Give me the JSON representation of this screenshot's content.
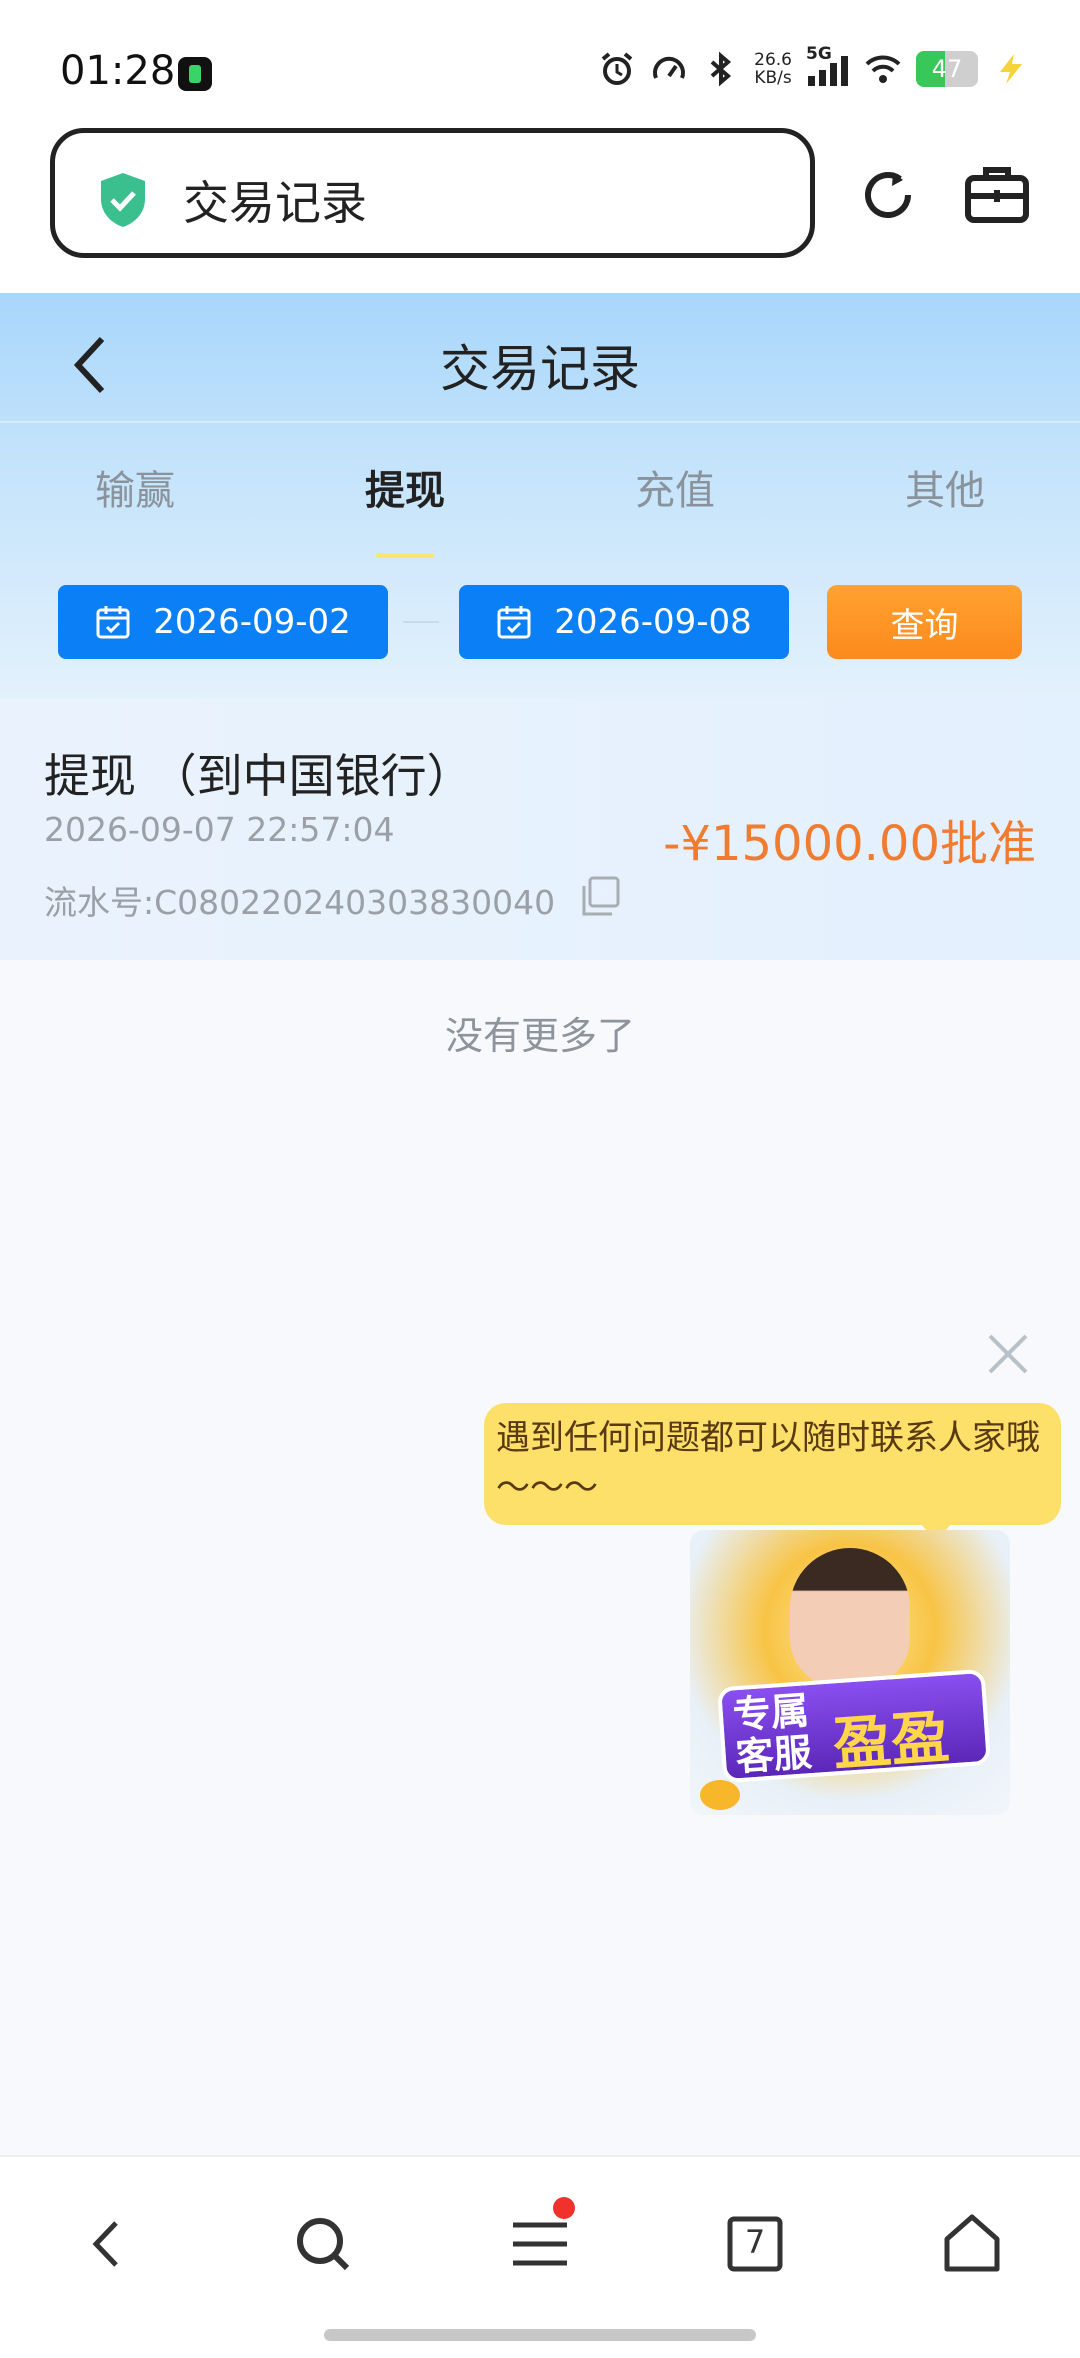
{
  "status_bar": {
    "time": "01:28",
    "net_speed_value": "26.6",
    "net_speed_unit": "KB/s",
    "network_type": "5G",
    "battery_level": "47",
    "battery_fraction": 0.47
  },
  "browser": {
    "url_title": "交易记录",
    "security_icon": "shield-check-icon",
    "refresh_icon": "refresh-icon",
    "toolbox_icon": "toolbox-icon"
  },
  "page": {
    "title": "交易记录",
    "tabs": [
      {
        "label": "输赢",
        "active": false
      },
      {
        "label": "提现",
        "active": true
      },
      {
        "label": "充值",
        "active": false
      },
      {
        "label": "其他",
        "active": false
      }
    ],
    "filter": {
      "start_date": "2026-09-02",
      "end_date": "2026-09-08",
      "query_label": "查询"
    },
    "records": [
      {
        "title": "提现 （到中国银行）",
        "time": "2026-09-07 22:57:04",
        "serial": "流水号:C080220240303830040",
        "amount": "-¥15000.00批准"
      }
    ],
    "no_more": "没有更多了"
  },
  "support": {
    "bubble_text": "遇到任何问题都可以随时联系人家哦～～～",
    "badge_line1": "专属客服",
    "badge_line2": "盈盈"
  },
  "colors": {
    "primary_blue": "#0b7ff5",
    "query_orange": "#fc8a1c",
    "amount_orange": "#f07c32",
    "bubble_yellow": "#fde06a",
    "tab_indicator": "#ffe56b"
  },
  "bottom_nav": {
    "tab_count": "7",
    "icons": [
      "back-icon",
      "search-icon",
      "menu-icon",
      "tabs-icon",
      "home-icon"
    ]
  }
}
